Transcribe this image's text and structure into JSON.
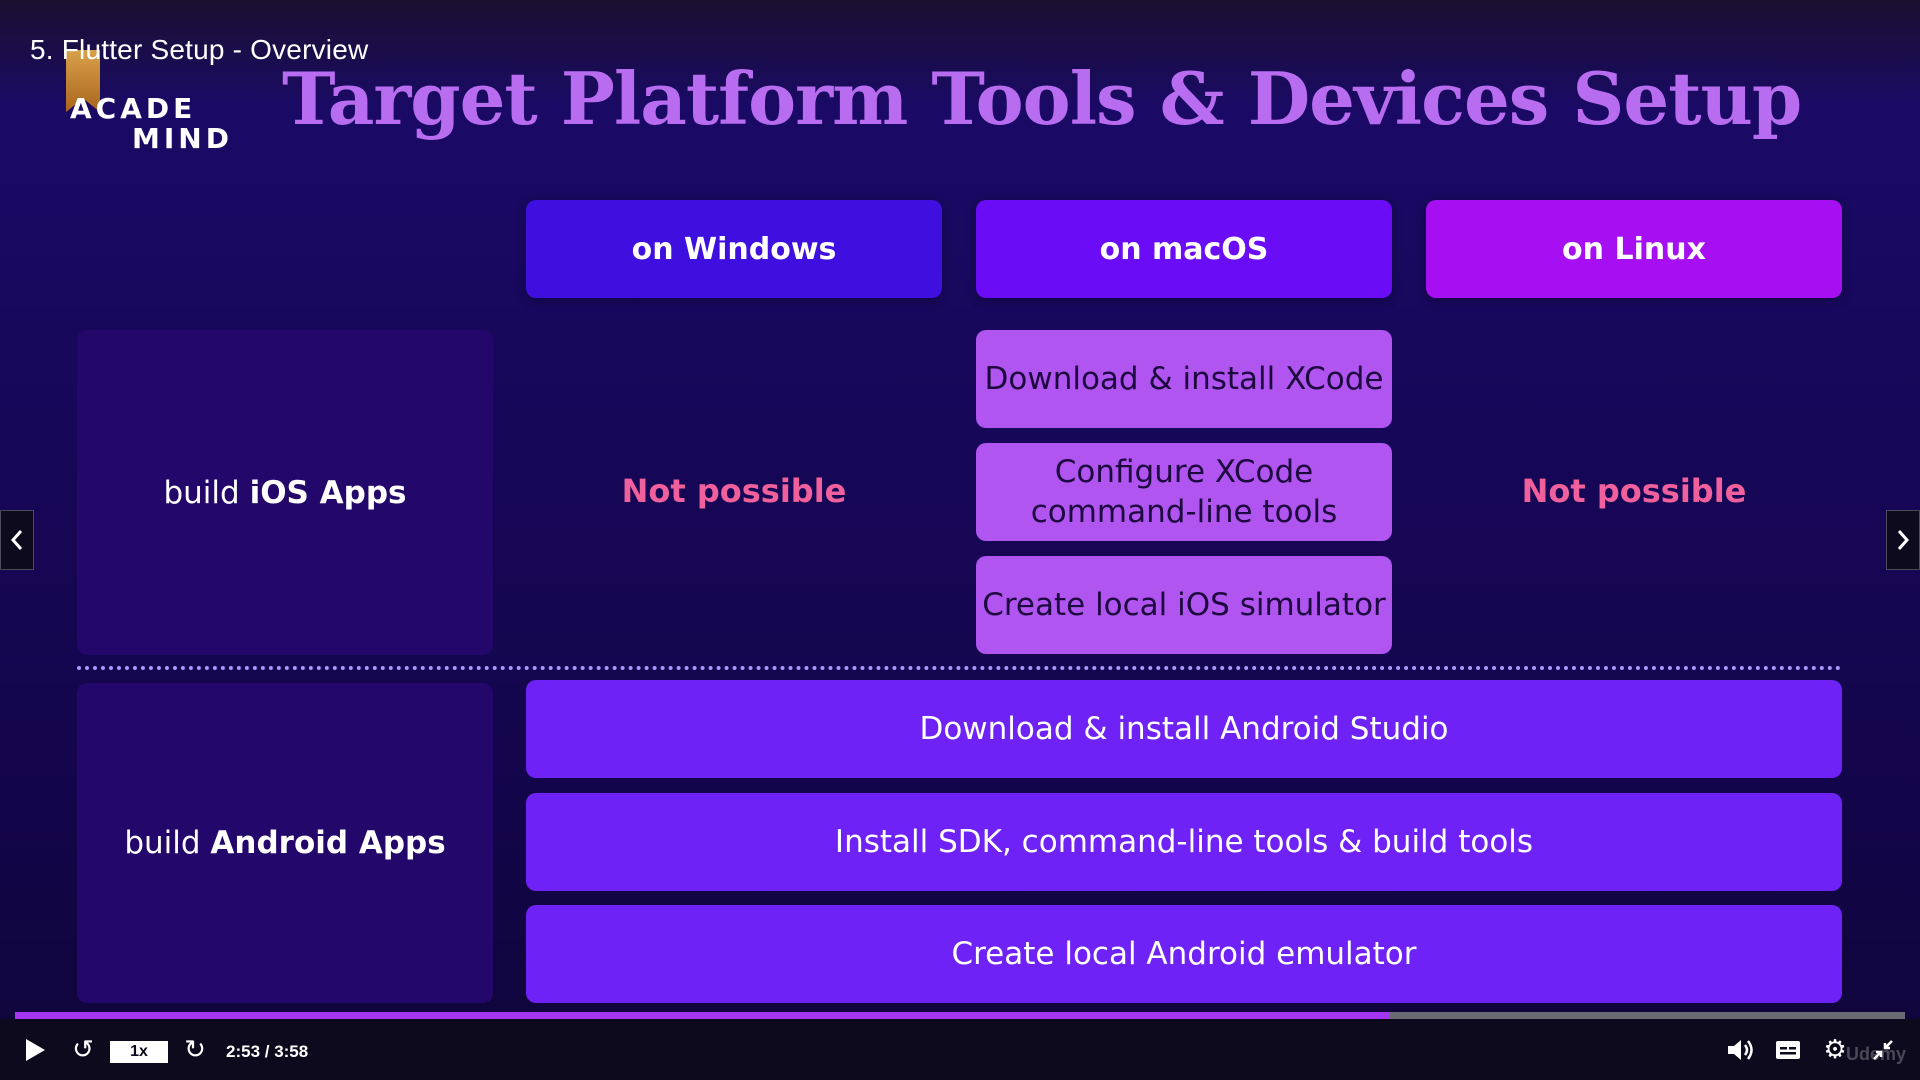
{
  "lecture": {
    "title": "5. Flutter Setup - Overview"
  },
  "logo": {
    "line1": "ACADE",
    "line2": "MIND"
  },
  "slide": {
    "title": "Target Platform Tools & Devices Setup",
    "columns": [
      "on Windows",
      "on macOS",
      "on Linux"
    ],
    "rows": {
      "ios": {
        "prefix": "build ",
        "strong": "iOS Apps"
      },
      "android": {
        "prefix": "build ",
        "strong": "Android Apps"
      }
    },
    "not_possible": "Not possible",
    "mac_ios_steps": [
      "Download & install XCode",
      "Configure XCode command-line tools",
      "Create local iOS simulator"
    ],
    "android_steps": [
      "Download & install Android Studio",
      "Install SDK, command-line tools & build tools",
      "Create local Android emulator"
    ]
  },
  "player": {
    "speed": "1x",
    "time": "2:53 / 3:58",
    "progress_fraction": 0.727,
    "watermark": "Udemy",
    "icons": {
      "play": "play-icon",
      "rewind": "rewind-icon",
      "forward": "forward-icon",
      "volume": "volume-icon",
      "captions": "captions-icon",
      "settings": "gear-icon",
      "fullscreen": "exit-fullscreen-icon"
    },
    "accent": "#a435f0"
  },
  "colors": {
    "windows": "#3f0fe0",
    "macos": "#6a0cf5",
    "linux": "#a60ff2",
    "not_possible": "#f0609c",
    "title": "#b86cf0"
  }
}
